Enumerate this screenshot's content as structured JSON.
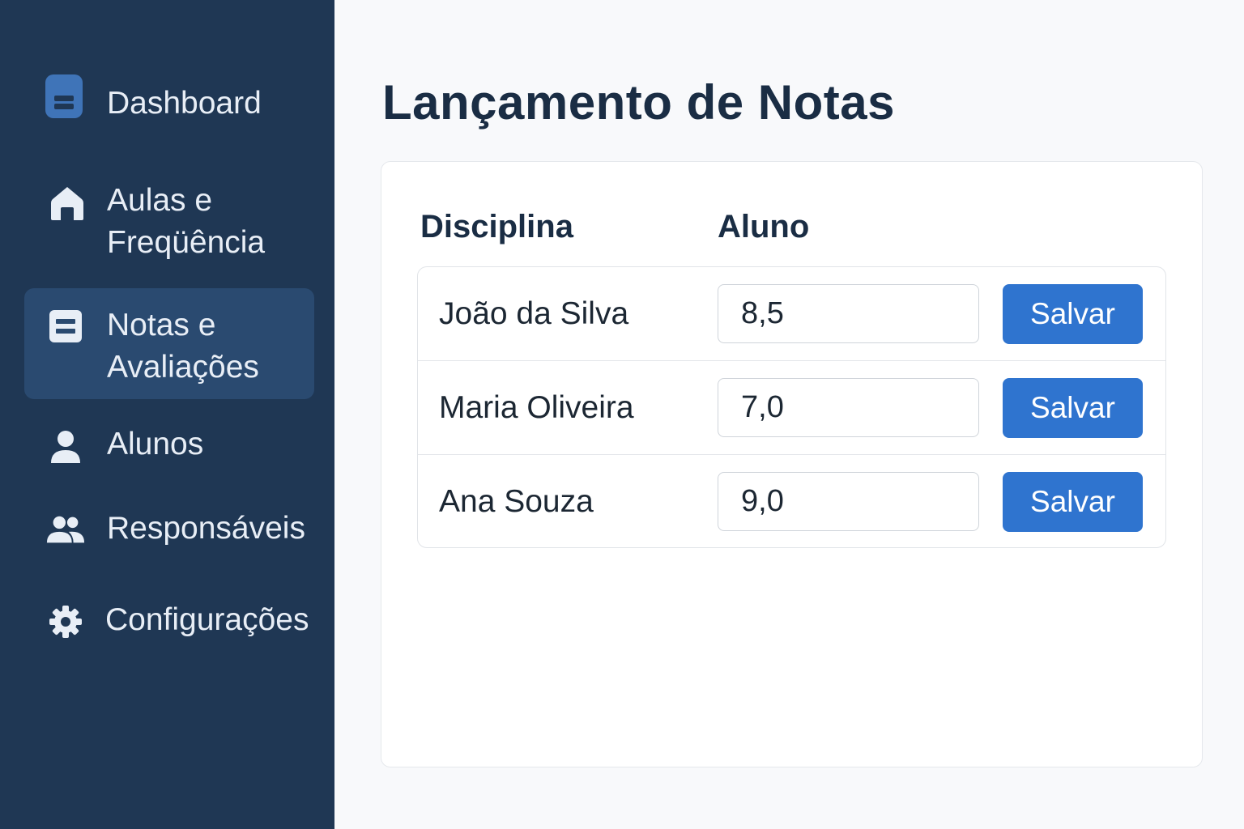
{
  "sidebar": {
    "items": [
      {
        "label": "Dashboard",
        "icon": "database-icon",
        "active": false
      },
      {
        "label": "Aulas e\nFreqüência",
        "icon": "home-icon",
        "active": false
      },
      {
        "label": "Notas e\nAvaliações",
        "icon": "list-document-icon",
        "active": true
      },
      {
        "label": "Alunos",
        "icon": "user-icon",
        "active": false
      },
      {
        "label": "Responsáveis",
        "icon": "users-icon",
        "active": false
      },
      {
        "label": "Configurações",
        "icon": "gear-icon",
        "active": false
      }
    ]
  },
  "main": {
    "title": "Lançamento de Notas",
    "columns": [
      "Disciplina",
      "Aluno"
    ],
    "rows": [
      {
        "name": "João da Silva",
        "grade": "8,5",
        "button": "Salvar"
      },
      {
        "name": "Maria Oliveira",
        "grade": "7,0",
        "button": "Salvar"
      },
      {
        "name": "Ana Souza",
        "grade": "9,0",
        "button": "Salvar"
      }
    ]
  },
  "colors": {
    "sidebar_bg": "#1f3754",
    "sidebar_active": "#2a4a70",
    "accent": "#2f74cf",
    "title": "#1a2d44"
  }
}
